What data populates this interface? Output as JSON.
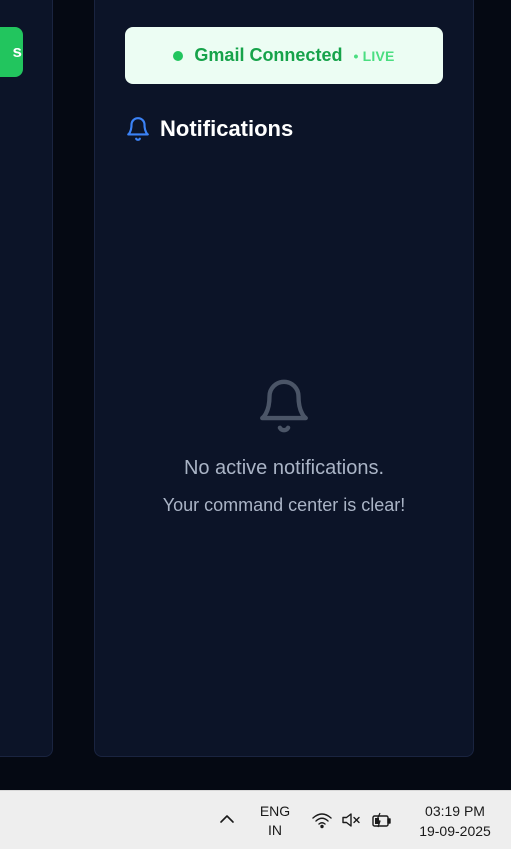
{
  "left_panel": {
    "button_label_fragment": "s",
    "accent_color": "#22c55e"
  },
  "gmail_status": {
    "label": "Gmail Connected",
    "live_label": "• LIVE",
    "status_color": "#22c55e"
  },
  "notifications": {
    "title": "Notifications",
    "icon": "bell-icon",
    "empty_title": "No active notifications.",
    "empty_subtitle": "Your command center is clear!"
  },
  "taskbar": {
    "language_line1": "ENG",
    "language_line2": "IN",
    "time": "03:19 PM",
    "date": "19-09-2025",
    "icons": [
      "chevron-up-icon",
      "wifi-icon",
      "volume-muted-icon",
      "battery-charging-icon"
    ]
  }
}
